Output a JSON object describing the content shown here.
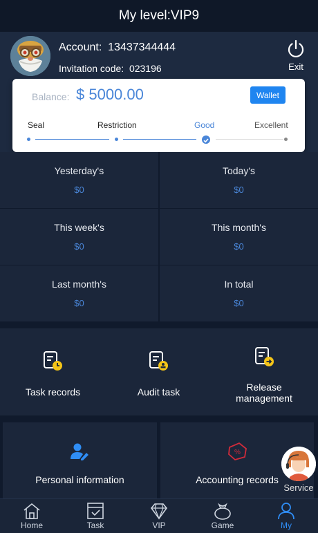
{
  "header": {
    "title": "My level:VIP9"
  },
  "user": {
    "account_label": "Account:",
    "account_value": "13437344444",
    "invite_label": "Invitation code:",
    "invite_value": "023196",
    "exit_label": "Exit"
  },
  "balance": {
    "label": "Balance:",
    "value": "$ 5000.00",
    "wallet_label": "Wallet",
    "levels": [
      "Seal",
      "Restriction",
      "Good",
      "Excellent"
    ],
    "current_level": "Good"
  },
  "stats": [
    {
      "label": "Yesterday's",
      "value": "$0"
    },
    {
      "label": "Today's",
      "value": "$0"
    },
    {
      "label": "This week's",
      "value": "$0"
    },
    {
      "label": "This month's",
      "value": "$0"
    },
    {
      "label": "Last month's",
      "value": "$0"
    },
    {
      "label": "In total",
      "value": "$0"
    }
  ],
  "quick_links": [
    {
      "label": "Task records",
      "icon": "task-records-icon"
    },
    {
      "label": "Audit task",
      "icon": "audit-task-icon"
    },
    {
      "label": "Release management",
      "icon": "release-management-icon"
    }
  ],
  "cards": [
    {
      "label": "Personal information",
      "icon": "user-edit-icon"
    },
    {
      "label": "Accounting records",
      "icon": "percent-ticket-icon"
    }
  ],
  "service": {
    "label": "Service"
  },
  "tabs": [
    {
      "label": "Home",
      "icon": "home-icon"
    },
    {
      "label": "Task",
      "icon": "task-icon"
    },
    {
      "label": "VIP",
      "icon": "diamond-icon"
    },
    {
      "label": "Game",
      "icon": "money-bag-icon"
    },
    {
      "label": "My",
      "icon": "user-icon",
      "active": true
    }
  ],
  "colors": {
    "background": "#101a2c",
    "panel": "#1b263a",
    "accent": "#4a86d8",
    "wallet_button": "#1f85f0",
    "icon_yellow": "#f5c518",
    "icon_red": "#d12b3a"
  }
}
